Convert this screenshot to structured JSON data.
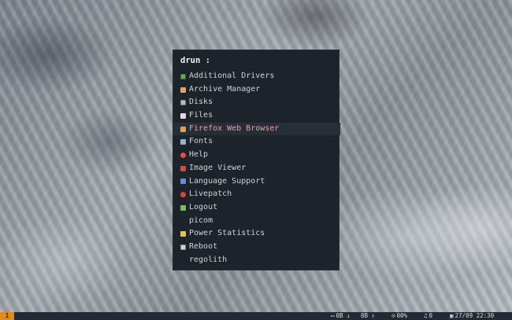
{
  "launcher": {
    "prompt": "drun :",
    "items": [
      {
        "label": "Additional Drivers",
        "icon": "circuit-board-icon",
        "color": "#6aa84f",
        "style": "boxed"
      },
      {
        "label": "Archive Manager",
        "icon": "archive-icon",
        "color": "#e6a35c",
        "style": ""
      },
      {
        "label": "Disks",
        "icon": "disk-icon",
        "color": "#b8bcc2",
        "style": "boxed"
      },
      {
        "label": "Files",
        "icon": "files-icon",
        "color": "#e4d7e4",
        "style": ""
      },
      {
        "label": "Firefox Web Browser",
        "icon": "firefox-icon",
        "color": "#f29d38",
        "style": ""
      },
      {
        "label": "Fonts",
        "icon": "fonts-icon",
        "color": "#8fb3c9",
        "style": ""
      },
      {
        "label": "Help",
        "icon": "help-lifebuoy-icon",
        "color": "#e64a4a",
        "style": "round"
      },
      {
        "label": "Image Viewer",
        "icon": "image-viewer-icon",
        "color": "#d9473f",
        "style": ""
      },
      {
        "label": "Language Support",
        "icon": "language-icon",
        "color": "#5b8fd6",
        "style": ""
      },
      {
        "label": "Livepatch",
        "icon": "livepatch-icon",
        "color": "#e0452f",
        "style": "round"
      },
      {
        "label": "Logout",
        "icon": "logout-icon",
        "color": "#7bbf4a",
        "style": ""
      },
      {
        "label": "picom",
        "icon": "",
        "color": "",
        "style": "none"
      },
      {
        "label": "Power Statistics",
        "icon": "power-statistics-icon",
        "color": "#e8c53a",
        "style": ""
      },
      {
        "label": "Reboot",
        "icon": "reboot-icon",
        "color": "#d0d3d7",
        "style": "boxed"
      },
      {
        "label": "regolith",
        "icon": "",
        "color": "",
        "style": "none"
      }
    ],
    "selected_index": 4
  },
  "bar": {
    "workspace": "1",
    "net_down": "0B",
    "net_up": "0B",
    "volume": "00%",
    "notifications": "0",
    "datetime": "27/09 22:30"
  },
  "colors": {
    "launcher_bg": "#1c232b",
    "selected_bg": "#262e37",
    "selected_text": "#e8a3a3",
    "workspace_accent": "#e08a1e",
    "bar_bg": "#232a33"
  }
}
